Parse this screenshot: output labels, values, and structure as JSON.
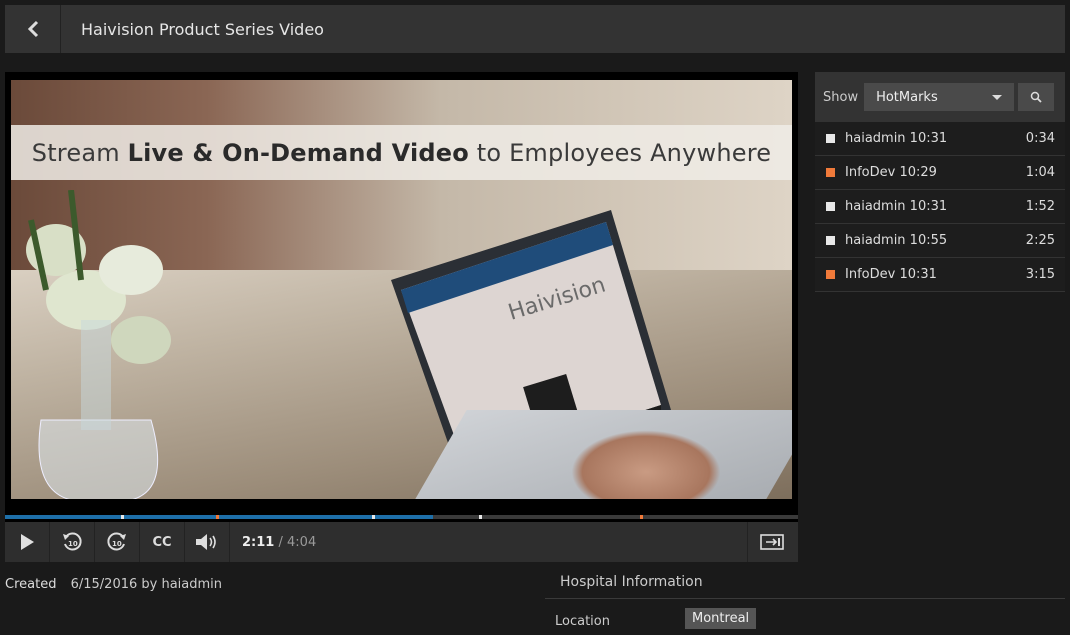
{
  "header": {
    "title": "Haivision Product Series Video",
    "back_icon": "chevron-left-icon"
  },
  "video": {
    "banner_pre": "Stream ",
    "banner_bold": "Live & On-Demand Video",
    "banner_post": " to Employees Anywhere",
    "progress_played": 0.54,
    "progress_buffered": 0.54,
    "hotmark_positions": [
      0.146,
      0.266,
      0.463,
      0.598,
      0.801
    ]
  },
  "controls": {
    "current_time": "2:11",
    "separator": "/",
    "duration": "4:04",
    "cc_label": "CC",
    "icons": [
      "play-icon",
      "rewind-10-icon",
      "forward-10-icon",
      "cc-icon",
      "volume-icon",
      "expand-icon"
    ]
  },
  "panel": {
    "show_label": "Show",
    "filter_value": "HotMarks",
    "hotmarks": [
      {
        "name": "haiadmin 10:31",
        "time": "0:34",
        "color": "#e8e8e8"
      },
      {
        "name": "InfoDev 10:29",
        "time": "1:04",
        "color": "#f07a3a"
      },
      {
        "name": "haiadmin 10:31",
        "time": "1:52",
        "color": "#e8e8e8"
      },
      {
        "name": "haiadmin 10:55",
        "time": "2:25",
        "color": "#e8e8e8"
      },
      {
        "name": "InfoDev 10:31",
        "time": "3:15",
        "color": "#f07a3a"
      }
    ]
  },
  "info": {
    "created_label": "Created",
    "created_value": "6/15/2016 by haiadmin",
    "section_title": "Hospital Information",
    "location_label": "Location",
    "location_value": "Montreal"
  },
  "colors": {
    "accent": "#1e6fa8",
    "hotmark_user": "#e8e8e8",
    "hotmark_infodev": "#f07a3a"
  }
}
